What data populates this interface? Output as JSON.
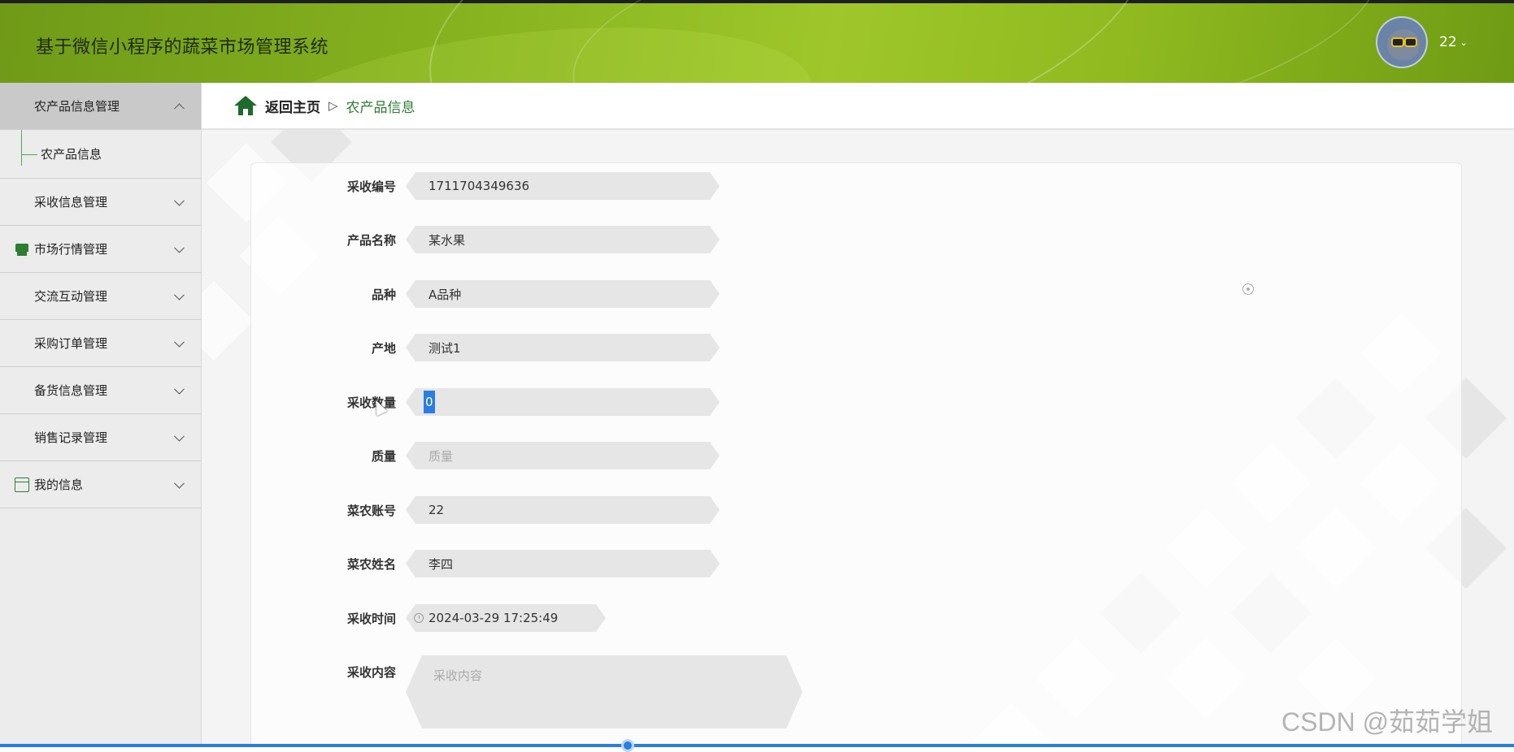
{
  "header": {
    "app_title": "基于微信小程序的蔬菜市场管理系统",
    "username": "22",
    "caret": "⌄"
  },
  "sidebar": {
    "items": [
      {
        "label": "农产品信息管理",
        "icon": "grid-icon",
        "expanded": true
      },
      {
        "label": "采收信息管理",
        "icon": "grid-icon"
      },
      {
        "label": "市场行情管理",
        "icon": "store-icon"
      },
      {
        "label": "交流互动管理",
        "icon": "grid-icon"
      },
      {
        "label": "采购订单管理",
        "icon": "grid-icon"
      },
      {
        "label": "备货信息管理",
        "icon": "grid-icon"
      },
      {
        "label": "销售记录管理",
        "icon": "grid-icon"
      },
      {
        "label": "我的信息",
        "icon": "wallet-icon"
      }
    ],
    "submenu": {
      "label": "农产品信息"
    }
  },
  "breadcrumb": {
    "home": "返回主页",
    "separator": "▷",
    "current": "农产品信息"
  },
  "form": {
    "fields": [
      {
        "label": "采收编号",
        "value": "1711704349636"
      },
      {
        "label": "产品名称",
        "value": "某水果"
      },
      {
        "label": "品种",
        "value": "A品种"
      },
      {
        "label": "产地",
        "value": "测试1"
      },
      {
        "label": "采收数量",
        "value": "0"
      },
      {
        "label": "质量",
        "placeholder": "质量"
      },
      {
        "label": "菜农账号",
        "value": "22"
      },
      {
        "label": "菜农姓名",
        "value": "李四"
      },
      {
        "label": "采收时间",
        "value": "2024-03-29 17:25:49"
      },
      {
        "label": "采收内容",
        "placeholder": "采收内容"
      }
    ]
  },
  "watermark": "CSDN @茹茹学姐",
  "colors": {
    "accent_green": "#2e7d32",
    "header_green": "#86b21f",
    "selection_blue": "#2a7de1"
  }
}
